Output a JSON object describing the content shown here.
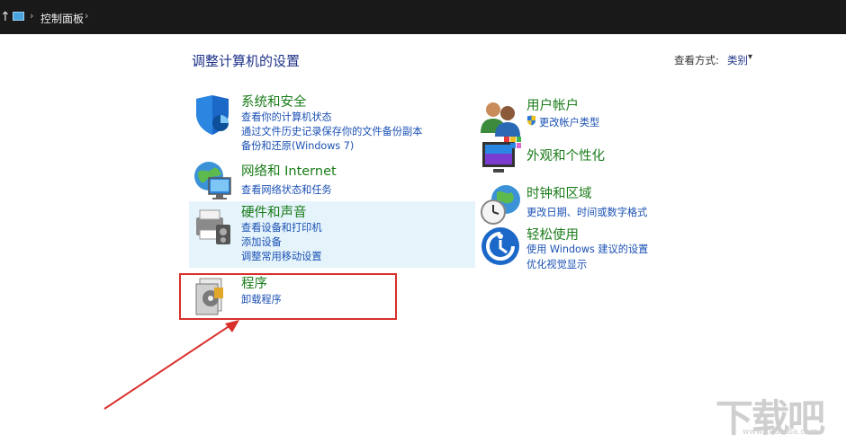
{
  "address_bar": {
    "up_glyph": "↑",
    "breadcrumb": "控制面板",
    "chevron": "›"
  },
  "header": {
    "title": "调整计算机的设置",
    "view_by_label": "查看方式:",
    "view_by_value": "类别",
    "view_by_arrow": "▾"
  },
  "categories_left": [
    {
      "title": "系统和安全",
      "icon": "shield-icon",
      "links": [
        "查看你的计算机状态",
        "通过文件历史记录保存你的文件备份副本",
        "备份和还原(Windows 7)"
      ]
    },
    {
      "title": "网络和 Internet",
      "icon": "network-icon",
      "links": [
        "查看网络状态和任务"
      ]
    },
    {
      "title": "硬件和声音",
      "icon": "printer-icon",
      "links": [
        "查看设备和打印机",
        "添加设备",
        "调整常用移动设置"
      ]
    },
    {
      "title": "程序",
      "icon": "programs-icon",
      "links": [
        "卸载程序"
      ]
    }
  ],
  "categories_right": [
    {
      "title": "用户帐户",
      "icon": "users-icon",
      "links": [
        "更改帐户类型"
      ]
    },
    {
      "title": "外观和个性化",
      "icon": "appearance-icon",
      "links": []
    },
    {
      "title": "时钟和区域",
      "icon": "clock-globe-icon",
      "links": [
        "更改日期、时间或数字格式"
      ]
    },
    {
      "title": "轻松使用",
      "icon": "ease-of-access-icon",
      "links": [
        "使用 Windows 建议的设置",
        "优化视觉显示"
      ]
    }
  ],
  "watermark": {
    "text": "下载吧",
    "sub": "www.xiazaiba.com"
  },
  "colors": {
    "title_blue": "#1e3287",
    "category_green": "#1a7c1a",
    "link_blue": "#1a50b4",
    "highlight_red": "#d9302c",
    "hover_bg": "#e5f3fb"
  }
}
